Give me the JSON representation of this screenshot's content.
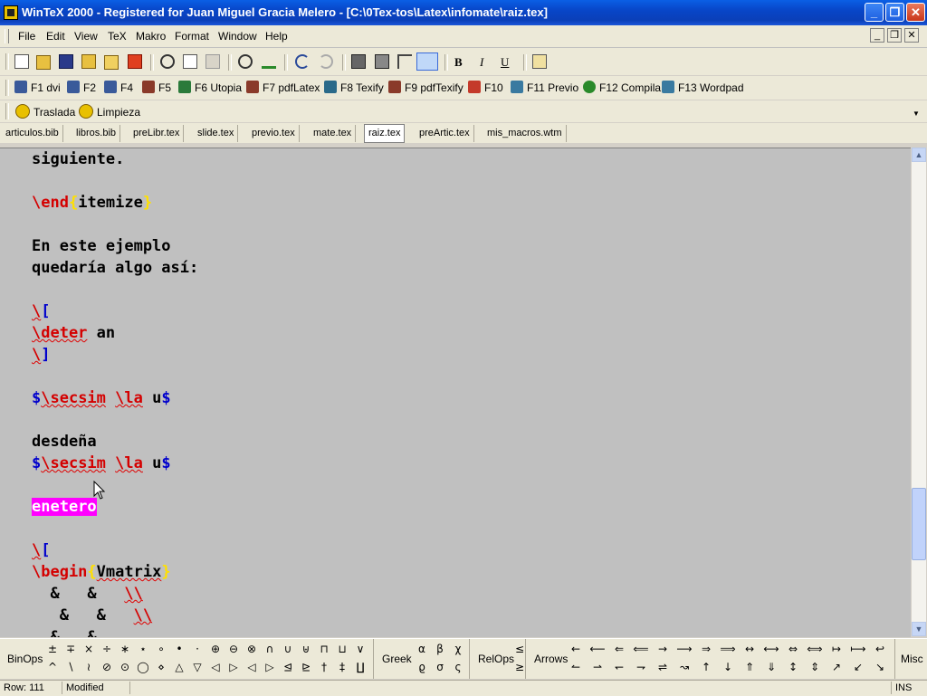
{
  "window": {
    "title": "WinTeX 2000 - Registered for Juan Miguel Gracia Melero - [C:\\0Tex-tos\\Latex\\infomate\\raiz.tex]",
    "minimize": "_",
    "maximize": "❐",
    "close": "✕"
  },
  "menu": [
    "File",
    "Edit",
    "View",
    "TeX",
    "Makro",
    "Format",
    "Window",
    "Help"
  ],
  "mdi": {
    "minimize": "_",
    "restore": "❐",
    "close": "✕"
  },
  "toolbar": {
    "bold": "B",
    "italic": "I",
    "underline": "U"
  },
  "fkeys": [
    {
      "label": "F1 dvi",
      "color": "#3a5a9a"
    },
    {
      "label": "F2",
      "color": "#3a5a9a"
    },
    {
      "label": "F4",
      "color": "#3a5a9a"
    },
    {
      "label": "F5",
      "color": "#8a3a2a"
    },
    {
      "label": "F6 Utopia",
      "color": "#2a7a3a"
    },
    {
      "label": "F7 pdfLatex",
      "color": "#8a3a2a"
    },
    {
      "label": "F8 Texify",
      "color": "#2a6a8a"
    },
    {
      "label": "F9 pdfTexify",
      "color": "#8a3a2a"
    },
    {
      "label": "F10",
      "color": "#c43a2a"
    },
    {
      "label": "F11 Previo",
      "color": "#3a7aa0"
    },
    {
      "label": "F12 Compila",
      "color": "#2a8a2a"
    },
    {
      "label": "F13 Wordpad",
      "color": "#3a7aa0"
    }
  ],
  "macros": [
    {
      "label": "Traslada"
    },
    {
      "label": "Limpieza"
    }
  ],
  "tabs": [
    {
      "label": "articulos.bib",
      "active": false
    },
    {
      "label": "libros.bib",
      "active": false
    },
    {
      "label": "preLibr.tex",
      "active": false
    },
    {
      "label": "slide.tex",
      "active": false
    },
    {
      "label": "previo.tex",
      "active": false
    },
    {
      "label": "mate.tex",
      "active": false
    },
    {
      "label": "raiz.tex",
      "active": true
    },
    {
      "label": "preArtic.tex",
      "active": false
    },
    {
      "label": "mis_macros.wtm",
      "active": false
    }
  ],
  "editor": {
    "l1": "siguiente.",
    "l2_cmd": "\\end",
    "l2_ob": "{",
    "l2_arg": "itemize",
    "l2_cb": "}",
    "l3": "En este ejemplo",
    "l4": "quedaría algo así:",
    "l5a": "\\",
    "l5b": "[",
    "l6_cmd": "\\deter",
    "l6_rest": " an",
    "l7a": "\\",
    "l7b": "]",
    "l8_d1": "$",
    "l8_c1": "\\secsim",
    "l8_sp": " ",
    "l8_c2": "\\la",
    "l8_rest": " u",
    "l8_d2": "$",
    "l9": "desdeña",
    "l10_d1": "$",
    "l10_c1": "\\secsim",
    "l10_sp": " ",
    "l10_c2": "\\la",
    "l10_rest": " u",
    "l10_d2": "$",
    "l11": "enetero",
    "l12a": "\\",
    "l12b": "[",
    "l13_cmd": "\\begin",
    "l13_ob": "{",
    "l13_arg": "Vmatrix",
    "l13_cb": "}",
    "l14_a": "  &   &   ",
    "l14_b": "\\\\",
    "l15_a": "   &   &   ",
    "l15_b": "\\\\",
    "l16": "  &   &"
  },
  "symbols": {
    "binops_label": "BinOps",
    "binops_row1": [
      "±",
      "∓",
      "×",
      "÷",
      "∗",
      "⋆",
      "∘",
      "•",
      "·",
      "⊕",
      "⊖",
      "⊗",
      "∩",
      "∪",
      "⊎",
      "⊓",
      "⊔",
      "∨"
    ],
    "binops_row2": [
      "^",
      "∖",
      "≀",
      "⊘",
      "⊙",
      "◯",
      "⋄",
      "△",
      "▽",
      "◁",
      "▷",
      "◁",
      "▷",
      "⊴",
      "⊵",
      "†",
      "‡",
      "∐"
    ],
    "greek_label": "Greek",
    "greek_row1": [
      "α",
      "β",
      "χ"
    ],
    "greek_row2": [
      "ϱ",
      "σ",
      "ς"
    ],
    "relops_label": "RelOps",
    "relops_row1": [
      "≤"
    ],
    "relops_row2": [
      "≥"
    ],
    "arrows_label": "Arrows",
    "arrows_row1": [
      "←",
      "⟵",
      "⇐",
      "⟸",
      "→",
      "⟶",
      "⇒",
      "⟹",
      "↔",
      "⟷",
      "⇔",
      "⟺",
      "↦",
      "⟼",
      "↩"
    ],
    "arrows_row2": [
      "↼",
      "⇀",
      "↽",
      "⇁",
      "⇌",
      "↝",
      "↑",
      "↓",
      "⇑",
      "⇓",
      "↕",
      "⇕",
      "↗",
      "↙",
      "↘"
    ],
    "misc_label": "Misc"
  },
  "status": {
    "row": "Row: 111",
    "modified": "Modified",
    "mode": "INS"
  }
}
